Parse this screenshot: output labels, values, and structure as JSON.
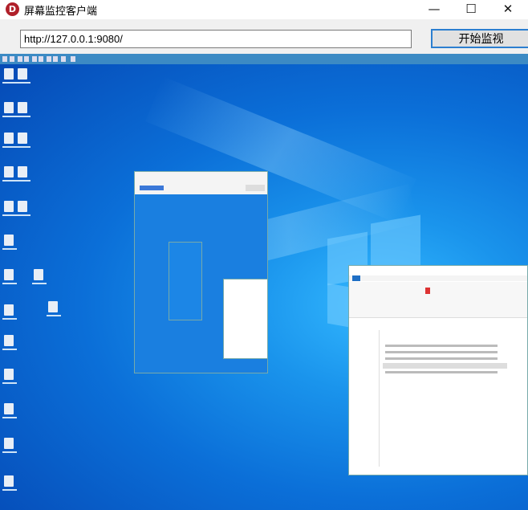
{
  "window": {
    "title": "屏幕监控客户端",
    "app_icon_letter": "D",
    "minimize": "—",
    "maximize": "☐",
    "close": "✕"
  },
  "toolbar": {
    "url_value": "http://127.0.0.1:9080/",
    "start_label": "开始监视"
  },
  "screen": {
    "accent": "#1a94ec",
    "content": "remote desktop screenshot"
  }
}
